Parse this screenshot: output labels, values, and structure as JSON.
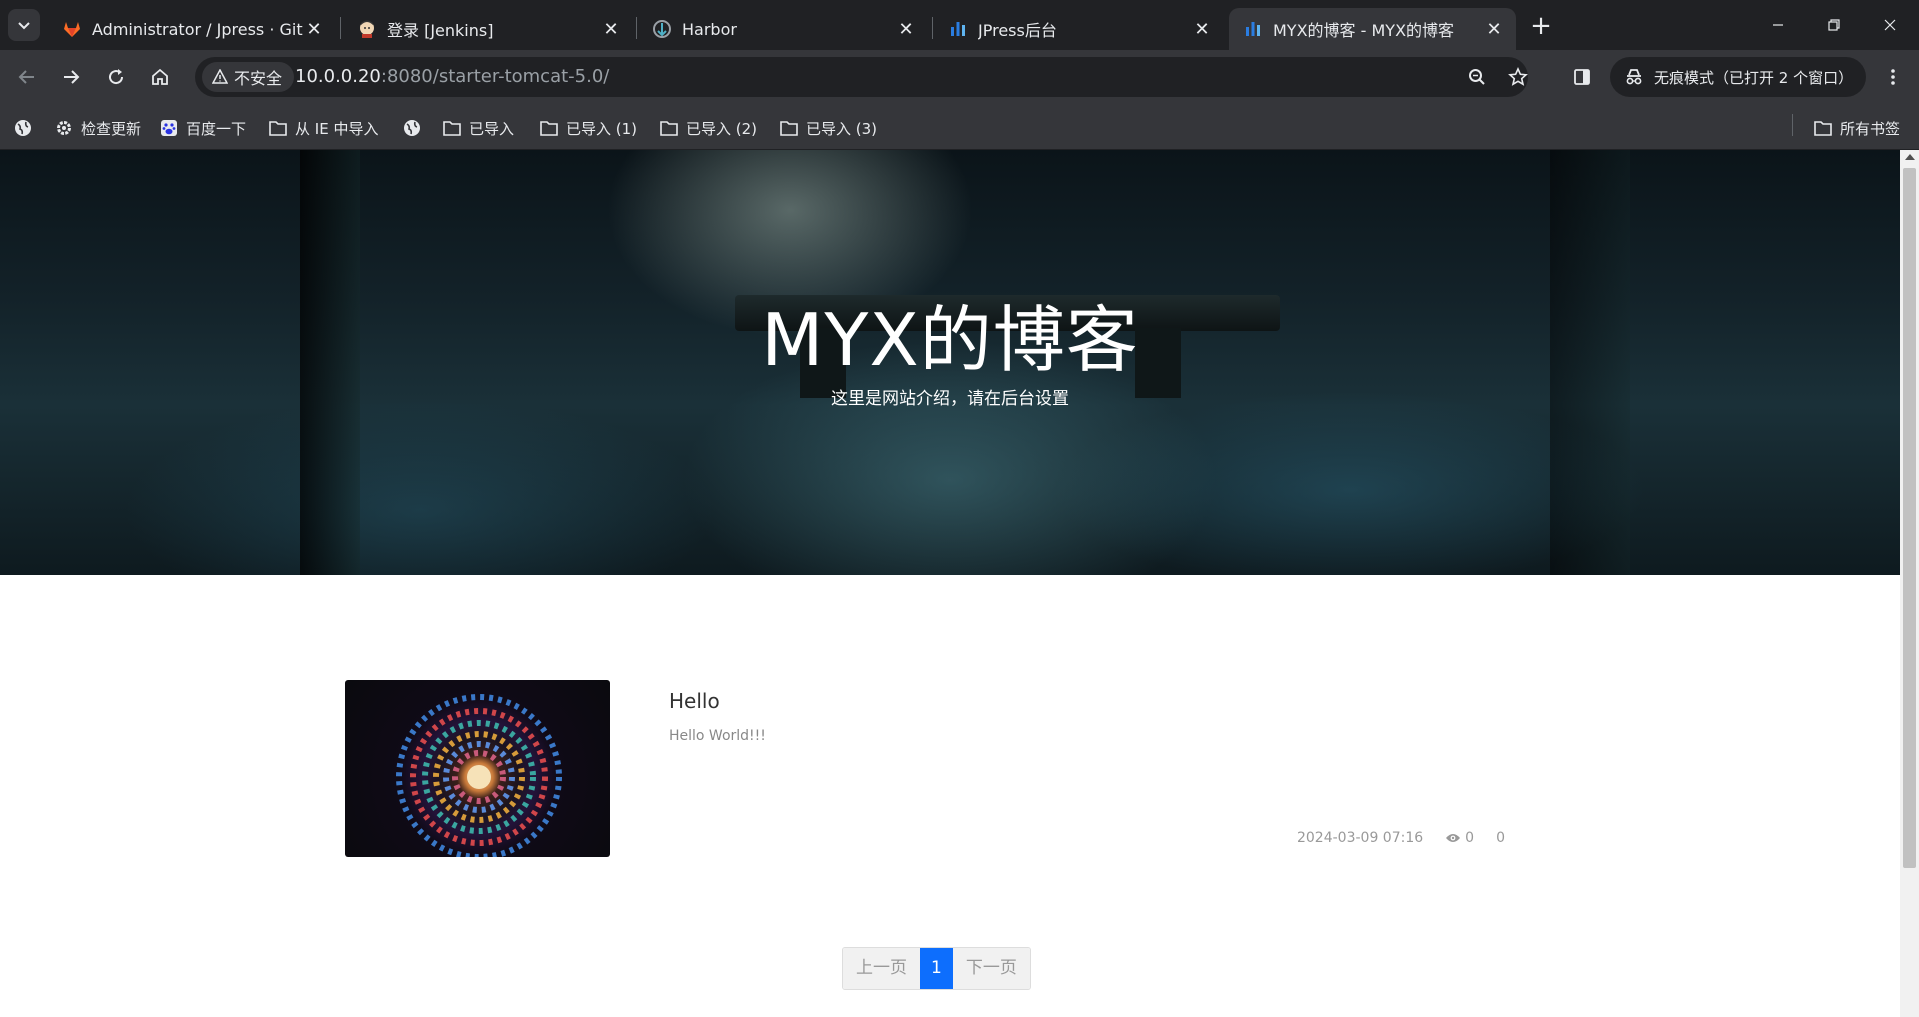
{
  "browser": {
    "tabs": [
      {
        "title": "Administrator / Jpress · GitLab",
        "icon": "gitlab-icon",
        "active": false
      },
      {
        "title": "登录 [Jenkins]",
        "icon": "jenkins-icon",
        "active": false
      },
      {
        "title": "Harbor",
        "icon": "harbor-icon",
        "active": false
      },
      {
        "title": "JPress后台",
        "icon": "jpress-icon",
        "active": false
      },
      {
        "title": "MYX的博客 - MYX的博客",
        "icon": "jpress-icon",
        "active": true
      }
    ],
    "address_bar": {
      "security_label": "不安全",
      "url_host": "10.0.0.20",
      "url_rest": ":8080/starter-tomcat-5.0/"
    },
    "incognito_label": "无痕模式（已打开 2 个窗口）",
    "bookmarks": [
      {
        "label": "",
        "icon": "globe-icon"
      },
      {
        "label": "检查更新",
        "icon": "gear-icon"
      },
      {
        "label": "百度一下",
        "icon": "baidu-icon"
      },
      {
        "label": "从 IE 中导入",
        "icon": "folder-icon"
      },
      {
        "label": "",
        "icon": "globe-icon"
      },
      {
        "label": "已导入",
        "icon": "folder-icon"
      },
      {
        "label": "已导入 (1)",
        "icon": "folder-icon"
      },
      {
        "label": "已导入 (2)",
        "icon": "folder-icon"
      },
      {
        "label": "已导入 (3)",
        "icon": "folder-icon"
      }
    ],
    "all_bookmarks_label": "所有书签"
  },
  "page": {
    "hero": {
      "title": "MYX的博客",
      "subtitle": "这里是网站介绍，请在后台设置"
    },
    "posts": [
      {
        "title": "Hello",
        "excerpt": "Hello World!!!",
        "date": "2024-03-09 07:16",
        "views": "0",
        "comments": "0"
      }
    ],
    "pagination": {
      "prev_label": "上一页",
      "current_page": "1",
      "next_label": "下一页"
    }
  },
  "colors": {
    "accent": "#0d6efd",
    "chrome_dark": "#202124",
    "chrome_toolbar": "#35363a"
  }
}
